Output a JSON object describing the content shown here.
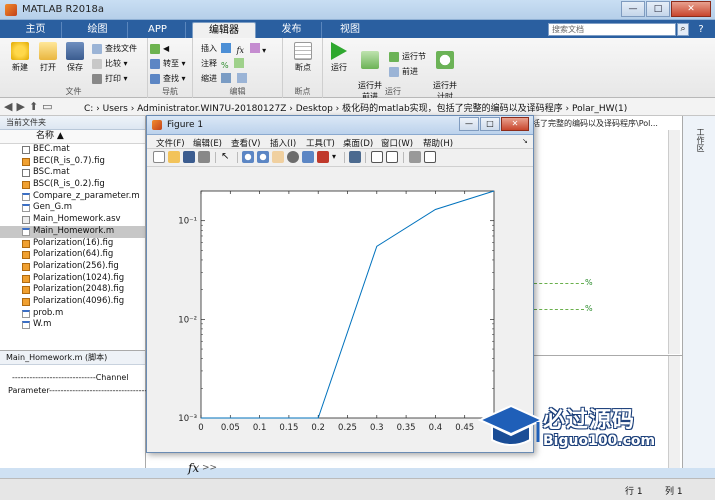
{
  "window": {
    "title": "MATLAB R2018a",
    "buttons": {
      "minimize": "—",
      "maximize": "□",
      "close": "✕"
    }
  },
  "tabs": [
    {
      "label": "主页"
    },
    {
      "label": "绘图"
    },
    {
      "label": "APP"
    },
    {
      "label": "编辑器"
    },
    {
      "label": "发布"
    },
    {
      "label": "视图"
    }
  ],
  "search": {
    "placeholder": "搜索文档"
  },
  "ribbon": {
    "file_group": {
      "label": "文件",
      "new": "新建",
      "open": "打开",
      "save": "保存",
      "find_files": "查找文件",
      "compare": "比较",
      "print": "打印"
    },
    "nav_group": {
      "label": "导航",
      "goto": "转至",
      "find": "查找"
    },
    "edit_group": {
      "label": "编辑",
      "insert": "插入",
      "comment": "注释",
      "indent": "缩进",
      "fx": "fx"
    },
    "breakpoints_group": {
      "label": "断点",
      "breakpoints": "断点"
    },
    "run_group": {
      "label": "运行",
      "run": "运行",
      "run_advance": "运行并\n前进",
      "run_section": "运行节",
      "advance": "前进",
      "run_time": "运行并\n计时"
    }
  },
  "address": {
    "path": "C: › Users › Administrator.WIN7U-20180127Z › Desktop › 极化码的matlab实现，包括了完整的编码以及译码程序 › Polar_HW(1)"
  },
  "file_browser": {
    "header": "当前文件夹",
    "column": "名称 ▲",
    "files": [
      {
        "name": "BEC.mat",
        "type": "mat"
      },
      {
        "name": "BEC(R_is_0.7).fig",
        "type": "fig"
      },
      {
        "name": "BSC.mat",
        "type": "mat"
      },
      {
        "name": "BSC(R_is_0.2).fig",
        "type": "fig"
      },
      {
        "name": "Compare_z_parameter.m",
        "type": "m"
      },
      {
        "name": "Gen_G.m",
        "type": "m"
      },
      {
        "name": "Main_Homework.asv",
        "type": "asv"
      },
      {
        "name": "Main_Homework.m",
        "type": "m",
        "selected": true
      },
      {
        "name": "Polarization(16).fig",
        "type": "fig"
      },
      {
        "name": "Polarization(64).fig",
        "type": "fig"
      },
      {
        "name": "Polarization(256).fig",
        "type": "fig"
      },
      {
        "name": "Polarization(1024).fig",
        "type": "fig"
      },
      {
        "name": "Polarization(2048).fig",
        "type": "fig"
      },
      {
        "name": "Polarization(4096).fig",
        "type": "fig"
      },
      {
        "name": "prob.m",
        "type": "m"
      },
      {
        "name": "W.m",
        "type": "m"
      }
    ]
  },
  "details": {
    "title": "Main_Homework.m  (脚本)",
    "line1": "-----------------------------Channel",
    "line2": "Parameter-------------------------------------"
  },
  "editor": {
    "header": "括了完整的编码以及译码程序\\Pol...",
    "pct_marks": [
      "%",
      "%"
    ]
  },
  "side_panel": {
    "label": "工作区"
  },
  "command": {
    "prompt": "fx",
    "arrow": ">>"
  },
  "status": {
    "row_label": "行",
    "row_value": "1",
    "col_label": "列",
    "col_value": "1"
  },
  "figure": {
    "title": "Figure 1",
    "menu": [
      "文件(F)",
      "编辑(E)",
      "查看(V)",
      "插入(I)",
      "工具(T)",
      "桌面(D)",
      "窗口(W)",
      "帮助(H)"
    ]
  },
  "chart_data": {
    "type": "line",
    "title": "",
    "xlabel": "",
    "ylabel": "",
    "y_scale": "log",
    "xlim": [
      0,
      0.5
    ],
    "ylim": [
      0.001,
      0.2
    ],
    "x_ticks": [
      0,
      0.05,
      0.1,
      0.15,
      0.2,
      0.25,
      0.3,
      0.35,
      0.4,
      0.45
    ],
    "x_tick_labels": [
      "0",
      "0.05",
      "0.1",
      "0.15",
      "0.2",
      "0.25",
      "0.3",
      "0.35",
      "0.4",
      "0.45"
    ],
    "y_ticks": [
      0.001,
      0.01,
      0.1
    ],
    "y_tick_labels": [
      "10⁻³",
      "10⁻²",
      "10⁻¹"
    ],
    "series": [
      {
        "x": [
          0,
          0.1,
          0.2,
          0.3,
          0.4,
          0.5
        ],
        "y": [
          0.001,
          0.001,
          0.001,
          0.055,
          0.13,
          0.2
        ],
        "color": "#0072BD"
      }
    ],
    "grid": false
  },
  "watermark": {
    "line1": "必过源码",
    "line2": "Biguo100.com"
  }
}
